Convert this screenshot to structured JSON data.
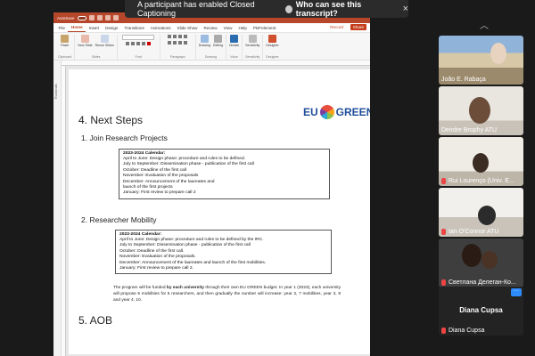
{
  "caption_banner": {
    "message": "A participant has enabled Closed Captioning",
    "link": "Who can see this transcript?",
    "close": "×"
  },
  "ppt": {
    "autosave": "AutoSave",
    "tabs": [
      {
        "label": "File"
      },
      {
        "label": "Home",
        "active": true
      },
      {
        "label": "Insert"
      },
      {
        "label": "Design"
      },
      {
        "label": "Transitions"
      },
      {
        "label": "Animations"
      },
      {
        "label": "Slide Show"
      },
      {
        "label": "Review"
      },
      {
        "label": "View"
      },
      {
        "label": "Help"
      },
      {
        "label": "PDFelement"
      }
    ],
    "record": "Record",
    "share": "Share",
    "ribbon": {
      "clipboard": {
        "paste": "Paste",
        "group": "Clipboard"
      },
      "slides": {
        "new_slide": "New Slide",
        "reuse": "Reuse Slides",
        "group": "Slides"
      },
      "font_group": "Font",
      "paragraph_group": "Paragraph",
      "drawing": {
        "btn": "Drawing",
        "group": "Drawing"
      },
      "editing": {
        "btn": "Editing"
      },
      "voice": {
        "btn": "Dictate",
        "group": "Voice"
      },
      "sensitivity": {
        "btn": "Sensitivity",
        "group": "Sensitivity"
      },
      "designer": {
        "btn": "Designer",
        "group": "Designer"
      }
    },
    "thumbnails_label": "Thumbnails"
  },
  "slide": {
    "heading": "4. Next Steps",
    "logo": {
      "left": "EU",
      "right": "GREEN"
    },
    "section1": "1. Join Research Projects",
    "box1": {
      "title": "2023-2024 Calendar:",
      "lines": [
        "April to June: Design phase: procedure and rules to be defined.",
        "July to September: Dissemination phase - publication of the first call",
        "October: Deadline of the first call",
        "November: Evaluation of the proposals",
        "December: Announcement of the laureates and",
        " launch of the first projects",
        "January: First review to prepare call 2"
      ]
    },
    "section2": "2. Researcher Mobility",
    "box2": {
      "title": "2023-2024 Calendar:",
      "lines": [
        "April to June: Design phase: procedure and rules to be defined by the IRC.",
        "July to September: Dissemination phase - publication of the first call",
        "October: Deadline of the first call.",
        "November: Evaluation of the proposals.",
        "December: Announcement of the laureates and launch of the first mobilities.",
        "January: First review to prepare call 2."
      ]
    },
    "funded": {
      "pre": "The program will be funded ",
      "bold": "by each university",
      "post": " through their own EU GREEN budget. In year 1 (2023), each university will propose 5 mobilities for 5 researchers, and then gradually the number will increase: year 2, 7 mobilities, year 3, 9 and year 4, 10."
    },
    "section3": "5. AOB"
  },
  "participants": [
    {
      "name": "João E. Rabaça",
      "muted": false
    },
    {
      "name": "Deirdre Brophy ATU",
      "muted": false
    },
    {
      "name": "Rui Lourenço (Univ. E...",
      "muted": true
    },
    {
      "name": "Ian O'Connor ATU",
      "muted": true
    },
    {
      "name": "Светлана Делеган-Ко...",
      "muted": true
    },
    {
      "name": "Diana Cupsa",
      "muted": true,
      "big_label": "Diana Cupsa",
      "more": "···"
    }
  ],
  "colors": {
    "ppt_accent": "#b7472a",
    "zoom_blue": "#2d8cff",
    "mic_muted": "#e44444"
  }
}
